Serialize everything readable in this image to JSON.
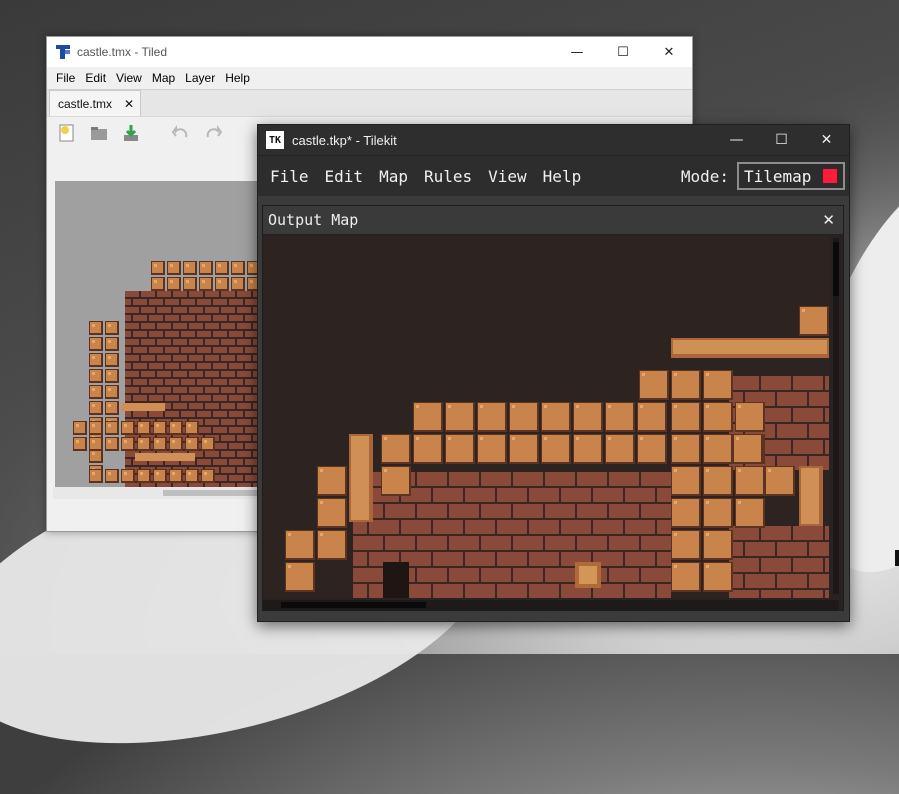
{
  "tiled": {
    "title": "castle.tmx - Tiled",
    "menu": [
      "File",
      "Edit",
      "View",
      "Map",
      "Layer",
      "Help"
    ],
    "tab_label": "castle.tmx",
    "tab_close": "✕",
    "window_buttons": {
      "minimize": "—",
      "maximize": "☐",
      "close": "✕"
    }
  },
  "tilekit": {
    "title": "castle.tkp* - Tilekit",
    "logo": "TK",
    "menu": [
      "File",
      "Edit",
      "Map",
      "Rules",
      "View",
      "Help"
    ],
    "mode_label": "Mode:",
    "mode_value": "Tilemap",
    "mode_swatch_color": "#ff1a3c",
    "window_buttons": {
      "minimize": "—",
      "maximize": "☐",
      "close": "✕"
    },
    "panel_title": "Output Map",
    "panel_close": "✕"
  },
  "colors": {
    "block": "#c8844a",
    "brick": "#8a4a3a",
    "dark_bg": "#2d2321"
  }
}
